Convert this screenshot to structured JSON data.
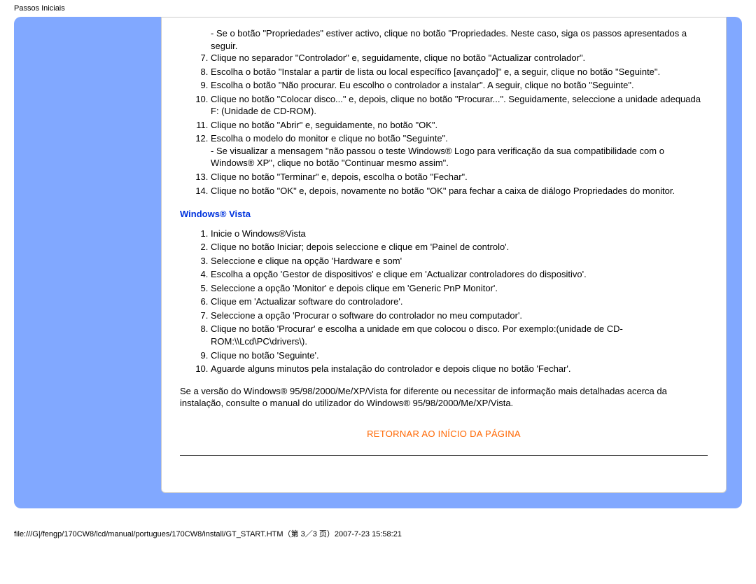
{
  "header": {
    "title": "Passos Iniciais"
  },
  "xp": {
    "dash": "- Se o botão \"Propriedades\" estiver activo, clique no botão \"Propriedades. Neste caso, siga os passos apresentados a seguir.",
    "s7": "Clique no separador \"Controlador\" e, seguidamente, clique no botão \"Actualizar controlador\".",
    "s8": "Escolha o botão \"Instalar a partir de lista ou local específico [avançado]\" e, a seguir, clique no botão \"Seguinte\".",
    "s9": "Escolha o botão \"Não procurar. Eu escolho o controlador a instalar\". A seguir, clique no botão \"Seguinte\".",
    "s10": "Clique no botão \"Colocar disco...\" e, depois, clique no botão \"Procurar...\". Seguidamente, seleccione a unidade adequada F: (Unidade de CD-ROM).",
    "s11": "Clique no botão \"Abrir\" e, seguidamente, no botão \"OK\".",
    "s12": "Escolha o modelo do monitor e clique no botão \"Seguinte\".",
    "s12b": "- Se visualizar a mensagem \"não passou o teste Windows® Logo para verificação da sua compatibilidade com o Windows® XP\", clique no botão \"Continuar mesmo assim\".",
    "s13": "Clique no botão \"Terminar\" e, depois, escolha o botão \"Fechar\".",
    "s14": "Clique no botão \"OK\" e, depois, novamente no botão \"OK\" para fechar a caixa de diálogo Propriedades do monitor."
  },
  "vista": {
    "heading": "Windows® Vista",
    "s1": "Inicie o Windows®Vista",
    "s2": "Clique no botão Iniciar; depois seleccione e clique em 'Painel de controlo'.",
    "s3": "Seleccione e clique na opção 'Hardware e som'",
    "s4": "Escolha a opção 'Gestor de dispositivos' e clique em 'Actualizar controladores do dispositivo'.",
    "s5": "Seleccione a opção 'Monitor' e depois clique em 'Generic PnP Monitor'.",
    "s6": "Clique em 'Actualizar software do controladore'.",
    "s7": "Seleccione a opção 'Procurar o software do controlador no meu computador'.",
    "s8": "Clique no botão 'Procurar' e escolha a unidade em que colocou o disco. Por exemplo:(unidade de CD-ROM:\\\\Lcd\\PC\\drivers\\).",
    "s9": "Clique no botão 'Seguinte'.",
    "s10": "Aguarde alguns minutos pela instalação do controlador e depois clique no botão 'Fechar'."
  },
  "note": "Se a versão do Windows® 95/98/2000/Me/XP/Vista for diferente ou necessitar de informação mais detalhadas acerca da instalação, consulte o manual do utilizador do Windows® 95/98/2000/Me/XP/Vista.",
  "back_top": "RETORNAR AO INÍCIO DA PÁGINA",
  "footer": "file:///G|/fengp/170CW8/lcd/manual/portugues/170CW8/install/GT_START.HTM（第 3／3 页）2007-7-23 15:58:21"
}
